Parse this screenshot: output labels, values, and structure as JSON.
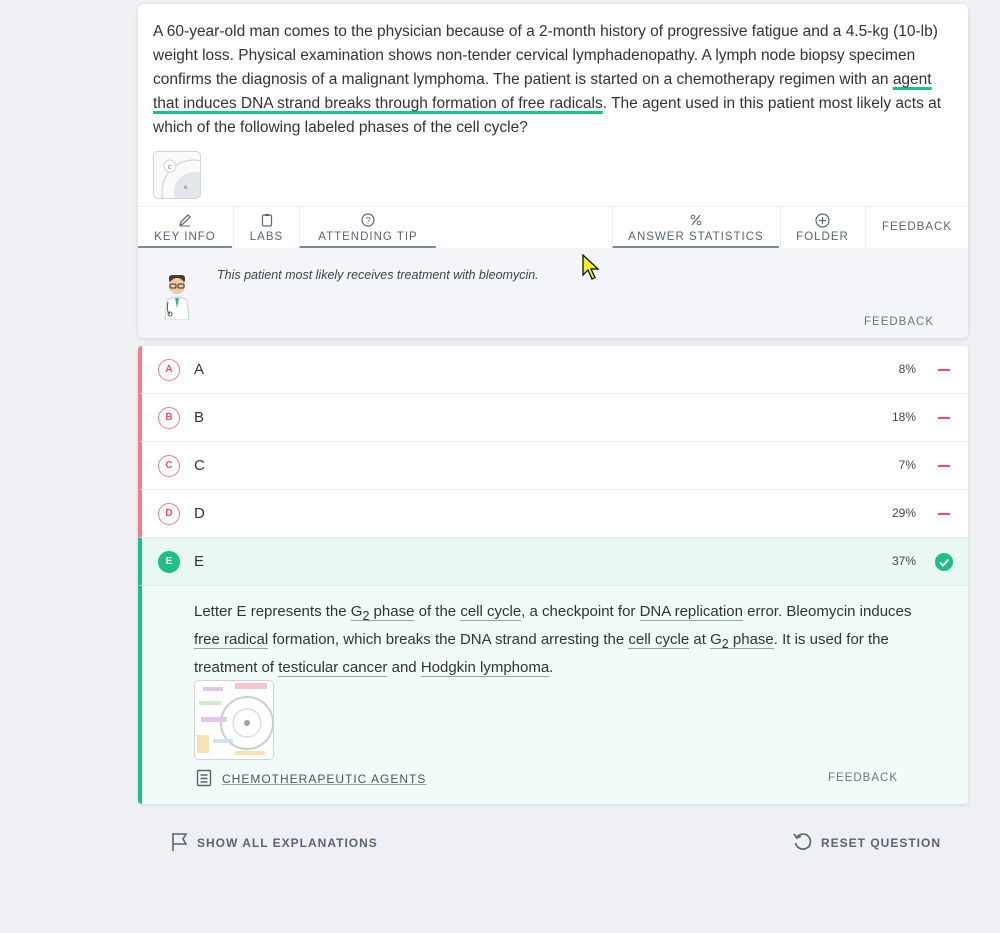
{
  "question": {
    "stem_before": "A 60-year-old man comes to the physician because of a 2-month history of progressive fatigue and a 4.5-kg (10-lb) weight loss. Physical examination shows non-tender cervical lymphadenopathy. A lymph node biopsy specimen confirms the diagnosis of a malignant lymphoma. The patient is started on a chemotherapy regimen with an ",
    "stem_highlight": "agent that induces DNA strand breaks through formation of free radicals",
    "stem_after": ". The agent used in this patient most likely acts at which of the following labeled phases of the cell cycle?"
  },
  "toolbar": {
    "key_info": "KEY INFO",
    "labs": "LABS",
    "attending_tip": "ATTENDING TIP",
    "answer_statistics": "ANSWER STATISTICS",
    "folder": "FOLDER",
    "feedback": "FEEDBACK"
  },
  "tip": {
    "text": "This patient most likely receives treatment with bleomycin.",
    "feedback": "FEEDBACK"
  },
  "answers": [
    {
      "letter": "A",
      "label": "A",
      "pct": "8%"
    },
    {
      "letter": "B",
      "label": "B",
      "pct": "18%"
    },
    {
      "letter": "C",
      "label": "C",
      "pct": "7%"
    },
    {
      "letter": "D",
      "label": "D",
      "pct": "29%"
    },
    {
      "letter": "E",
      "label": "E",
      "pct": "37%"
    }
  ],
  "explanation": {
    "t1": "Letter E represents the ",
    "g2a": "G",
    "sub": "2",
    "t2": " phase",
    "t3": " of the ",
    "cell_cycle": "cell cycle",
    "t4": ", a checkpoint for ",
    "dna_rep": "DNA replication",
    "t5": " error. Bleomycin induces ",
    "free_radical": "free radical",
    "t6": " formation, which breaks the DNA strand arresting the ",
    "cell_cycle2": "cell cycle",
    "t7": " at ",
    "g2b": "G",
    "sub2": "2",
    "t8": " phase",
    "t9": ". It is used for the treatment of ",
    "testicular": "testicular cancer",
    "t10": " and ",
    "hodgkin": "Hodgkin lymphoma",
    "t11": ".",
    "link": "CHEMOTHERAPEUTIC AGENTS",
    "feedback": "FEEDBACK"
  },
  "bottom": {
    "show_all": "SHOW ALL EXPLANATIONS",
    "reset": "RESET QUESTION"
  },
  "colors": {
    "correct": "#1cbf8a",
    "incorrect": "#f07c86"
  }
}
